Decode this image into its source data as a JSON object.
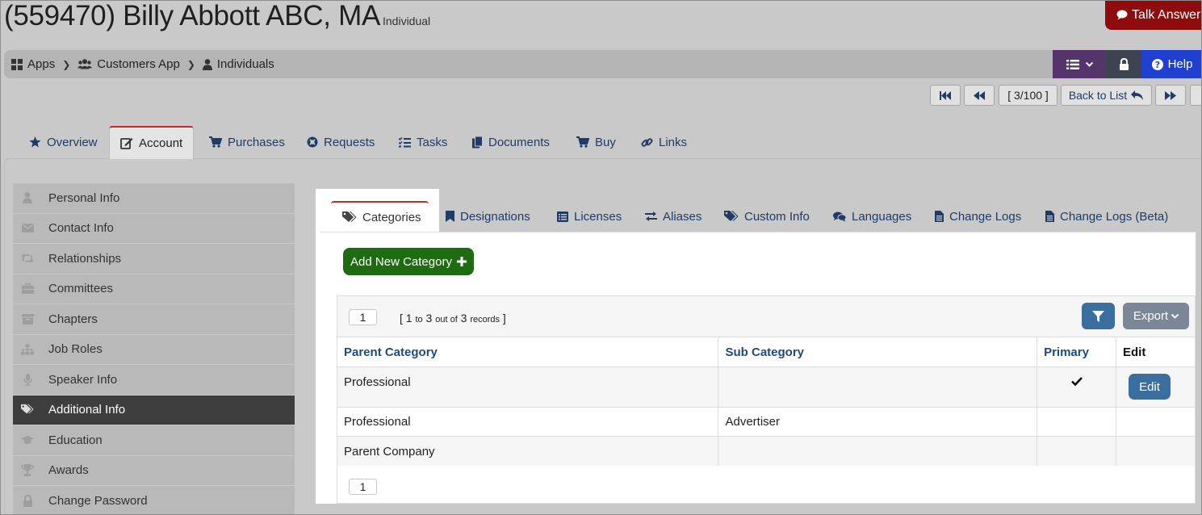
{
  "page": {
    "title": "(559470) Billy Abbott ABC, MA",
    "subtitle": "Individual",
    "talk_label": "Talk Answers"
  },
  "breadcrumb": {
    "items": [
      {
        "label": "Apps",
        "icon": "grid-icon"
      },
      {
        "label": "Customers App",
        "icon": "users-icon"
      },
      {
        "label": "Individuals",
        "icon": "user-icon"
      }
    ]
  },
  "toolbar": {
    "help_label": "Help"
  },
  "pager": {
    "count": "[ 3/100 ]",
    "back_label": "Back to List"
  },
  "main_tabs": [
    {
      "label": "Overview",
      "icon": "star-icon"
    },
    {
      "label": "Account",
      "icon": "edit-icon",
      "active": true
    },
    {
      "label": "Purchases",
      "icon": "cart-icon"
    },
    {
      "label": "Requests",
      "icon": "lifering-icon"
    },
    {
      "label": "Tasks",
      "icon": "tasks-icon"
    },
    {
      "label": "Documents",
      "icon": "documents-icon"
    },
    {
      "label": "Buy",
      "icon": "cart-icon"
    },
    {
      "label": "Links",
      "icon": "link-icon"
    }
  ],
  "sidebar": {
    "items": [
      {
        "label": "Personal Info",
        "icon": "user-icon"
      },
      {
        "label": "Contact Info",
        "icon": "envelope-icon"
      },
      {
        "label": "Relationships",
        "icon": "retweet-icon"
      },
      {
        "label": "Committees",
        "icon": "briefcase-icon"
      },
      {
        "label": "Chapters",
        "icon": "archive-icon"
      },
      {
        "label": "Job Roles",
        "icon": "sitemap-icon"
      },
      {
        "label": "Speaker Info",
        "icon": "microphone-icon"
      },
      {
        "label": "Additional Info",
        "icon": "tags-icon",
        "active": true
      },
      {
        "label": "Education",
        "icon": "graduation-cap-icon"
      },
      {
        "label": "Awards",
        "icon": "trophy-icon"
      },
      {
        "label": "Change Password",
        "icon": "lock-icon"
      }
    ]
  },
  "sub_tabs": [
    {
      "label": "Categories",
      "icon": "tags-icon",
      "active": true
    },
    {
      "label": "Designations",
      "icon": "bookmark-icon"
    },
    {
      "label": "Licenses",
      "icon": "list-alt-icon"
    },
    {
      "label": "Aliases",
      "icon": "exchange-icon"
    },
    {
      "label": "Custom Info",
      "icon": "tags-icon"
    },
    {
      "label": "Languages",
      "icon": "comments-icon"
    },
    {
      "label": "Change Logs",
      "icon": "file-icon"
    },
    {
      "label": "Change Logs (Beta)",
      "icon": "file-icon"
    }
  ],
  "categories": {
    "add_button_label": "Add New Category",
    "page_number": "1",
    "records": {
      "from": "1",
      "to_word": "to",
      "to": "3",
      "out_of_word": "out of",
      "total": "3",
      "records_word": "records"
    },
    "export_label": "Export",
    "columns": [
      "Parent Category",
      "Sub Category",
      "Primary",
      "Edit"
    ],
    "rows": [
      {
        "parent": "Professional",
        "sub": "",
        "primary": true,
        "edit": "Edit"
      },
      {
        "parent": "Professional",
        "sub": "Advertiser",
        "primary": false,
        "edit": ""
      },
      {
        "parent": "Parent Company",
        "sub": "",
        "primary": false,
        "edit": ""
      }
    ],
    "footer_page_number": "1"
  },
  "colors": {
    "talk": "#8f0c0c",
    "menu": "#55336b",
    "help": "#1f3fd1",
    "add_button": "#1e6b12",
    "edit_button": "#3a6e9e",
    "active_tab_border": "#c0292c"
  }
}
